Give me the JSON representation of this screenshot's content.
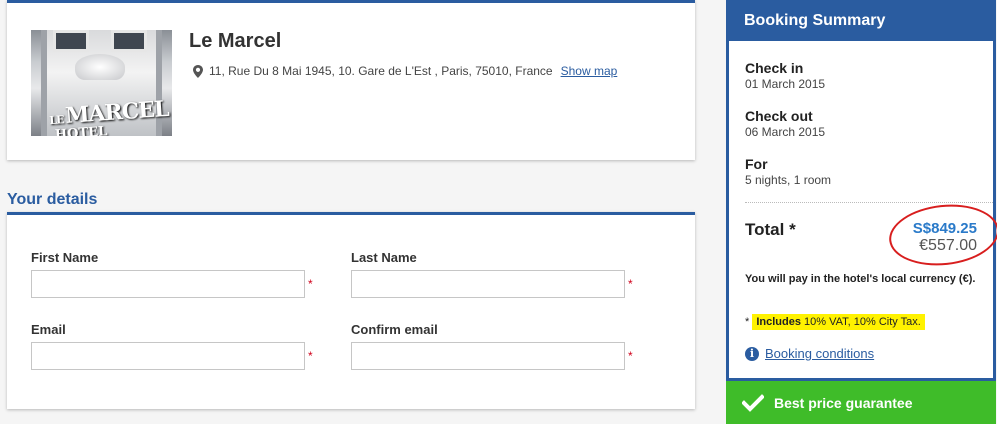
{
  "hotel": {
    "name": "Le Marcel",
    "address": "11, Rue Du 8 Mai 1945, 10. Gare de L'Est , Paris, 75010, France",
    "show_map": "Show map",
    "image_sign_small": "LE",
    "image_sign": "MARCEL",
    "image_sign_sub": "HOTEL",
    "icons": {
      "address": "map-pin-icon"
    }
  },
  "details": {
    "title": "Your details",
    "fields": {
      "first_name": {
        "label": "First Name",
        "value": ""
      },
      "last_name": {
        "label": "Last Name",
        "value": ""
      },
      "email": {
        "label": "Email",
        "value": ""
      },
      "confirm_email": {
        "label": "Confirm email",
        "value": ""
      }
    },
    "required_marker": "*"
  },
  "summary": {
    "title": "Booking Summary",
    "check_in": {
      "label": "Check in",
      "value": "01 March 2015"
    },
    "check_out": {
      "label": "Check out",
      "value": "06 March 2015"
    },
    "for": {
      "label": "For",
      "value": "5 nights, 1 room"
    },
    "total": {
      "label": "Total *",
      "price_sgd": "S$849.25",
      "price_eur": "€557.00"
    },
    "pay_note": "You will pay in the hotel's local currency (€).",
    "tax_note_prefix": "*",
    "tax_note_bold": "Includes",
    "tax_note_rest": "10% VAT, 10% City Tax.",
    "booking_conditions": "Booking conditions",
    "icons": {
      "booking_conditions": "info-icon"
    }
  },
  "guarantee": {
    "label": "Best price guarantee",
    "icon": "checkmark-icon"
  },
  "colors": {
    "brand_blue": "#2a5ca0",
    "price_blue": "#2a7ac9",
    "guarantee_green": "#3fbc29",
    "required_red": "#d0021b",
    "highlight_yellow": "#fff200",
    "annotation_red": "#d81e1e"
  }
}
